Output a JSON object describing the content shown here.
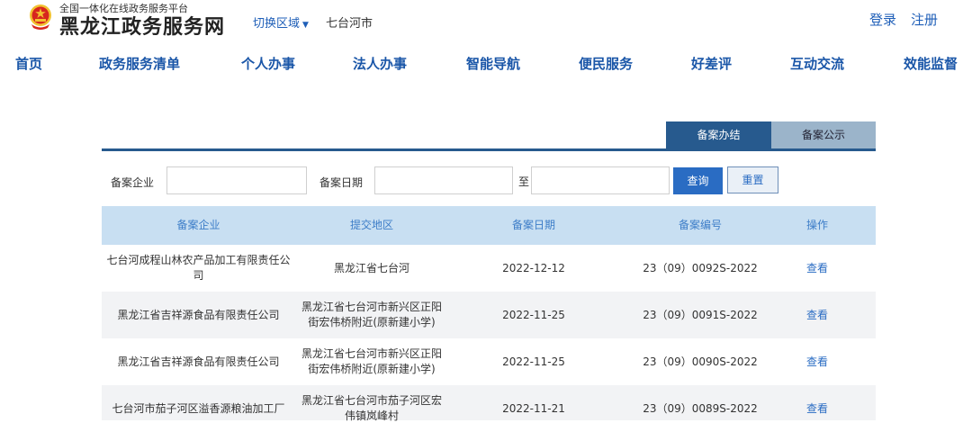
{
  "header": {
    "slogan": "全国一体化在线政务服务平台",
    "site_name": "黑龙江政务服务网",
    "switch_region": "切换区域",
    "current_city": "七台河市",
    "login": "登录",
    "register": "注册"
  },
  "nav": [
    "首页",
    "政务服务清单",
    "个人办事",
    "法人办事",
    "智能导航",
    "便民服务",
    "好差评",
    "互动交流",
    "效能监督"
  ],
  "tabs": {
    "active": "备案办结",
    "inactive": "备案公示"
  },
  "search": {
    "company_label": "备案企业",
    "company_value": "",
    "date_label": "备案日期",
    "date_from": "",
    "to_label": "至",
    "date_to": "",
    "query_button": "查询",
    "reset_button": "重置"
  },
  "table": {
    "headers": [
      "备案企业",
      "提交地区",
      "备案日期",
      "备案编号",
      "操作"
    ],
    "rows": [
      {
        "company": "七台河成程山林农产品加工有限责任公司",
        "region": "黑龙江省七台河",
        "date": "2022-12-12",
        "number": "23（09）0092S-2022",
        "action": "查看"
      },
      {
        "company": "黑龙江省吉祥源食品有限责任公司",
        "region": "黑龙江省七台河市新兴区正阳街宏伟桥附近(原新建小学)",
        "date": "2022-11-25",
        "number": "23（09）0091S-2022",
        "action": "查看"
      },
      {
        "company": "黑龙江省吉祥源食品有限责任公司",
        "region": "黑龙江省七台河市新兴区正阳街宏伟桥附近(原新建小学)",
        "date": "2022-11-25",
        "number": "23（09）0090S-2022",
        "action": "查看"
      },
      {
        "company": "七台河市茄子河区溢香源粮油加工厂",
        "region": "黑龙江省七台河市茄子河区宏伟镇岚峰村",
        "date": "2022-11-21",
        "number": "23（09）0089S-2022",
        "action": "查看"
      }
    ]
  },
  "colors": {
    "accent": "#275a8e",
    "link": "#2a6cc3",
    "header_row": "#c8dff2",
    "emblem_red": "#d7261e",
    "emblem_gold": "#f2c230"
  }
}
